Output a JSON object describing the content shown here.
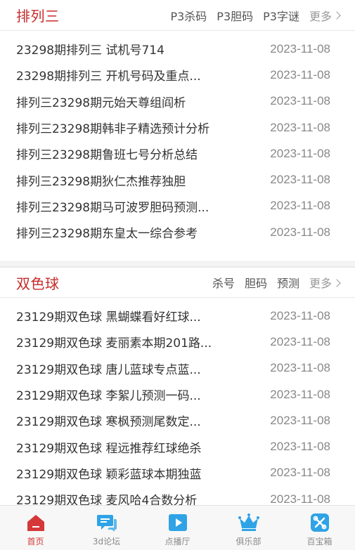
{
  "section1": {
    "title": "排列三",
    "links": [
      "P3杀码",
      "P3胆码",
      "P3字谜"
    ],
    "more": "更多",
    "items": [
      {
        "title": "23298期排列三 试机号714",
        "date": "2023-11-08"
      },
      {
        "title": "23298期排列三 开机号码及重点...",
        "date": "2023-11-08"
      },
      {
        "title": "排列三23298期元始天尊组阎析",
        "date": "2023-11-08"
      },
      {
        "title": "排列三23298期韩非子精选预计分析",
        "date": "2023-11-08"
      },
      {
        "title": "排列三23298期鲁班七号分析总结",
        "date": "2023-11-08"
      },
      {
        "title": "排列三23298期狄仁杰推荐独胆",
        "date": "2023-11-08"
      },
      {
        "title": "排列三23298期马可波罗胆码预测...",
        "date": "2023-11-08"
      },
      {
        "title": "排列三23298期东皇太一综合参考",
        "date": "2023-11-08"
      }
    ]
  },
  "section2": {
    "title": "双色球",
    "links": [
      "杀号",
      "胆码",
      "预测"
    ],
    "more": "更多",
    "items": [
      {
        "title": "23129期双色球 黑蝴蝶看好红球...",
        "date": "2023-11-08"
      },
      {
        "title": "23129期双色球 麦丽素本期201路...",
        "date": "2023-11-08"
      },
      {
        "title": "23129期双色球 唐儿蓝球专点蓝...",
        "date": "2023-11-08"
      },
      {
        "title": "23129期双色球 李絮儿预测一码...",
        "date": "2023-11-08"
      },
      {
        "title": "23129期双色球 寒枫预测尾数定...",
        "date": "2023-11-08"
      },
      {
        "title": "23129期双色球 程远推荐红球绝杀",
        "date": "2023-11-08"
      },
      {
        "title": "23129期双色球 颖彩蓝球本期独蓝",
        "date": "2023-11-08"
      },
      {
        "title": "23129期双色球 麦风哈4合数分析",
        "date": "2023-11-08"
      }
    ]
  },
  "tabbar": {
    "tabs": [
      {
        "label": "首页",
        "icon": "home-icon",
        "active": true
      },
      {
        "label": "3d论坛",
        "icon": "chat-icon",
        "active": false
      },
      {
        "label": "点播厅",
        "icon": "play-icon",
        "active": false
      },
      {
        "label": "俱乐部",
        "icon": "crown-icon",
        "active": false
      },
      {
        "label": "百宝箱",
        "icon": "toolbox-icon",
        "active": false
      }
    ]
  },
  "colors": {
    "accent": "#c82a2a",
    "icon_blue": "#2fa3e6",
    "active_red": "#d43838"
  }
}
